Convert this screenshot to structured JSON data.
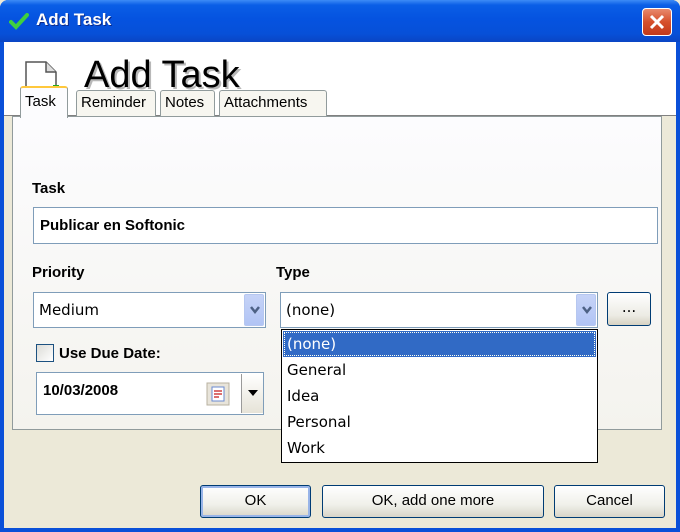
{
  "window": {
    "title": "Add Task"
  },
  "header": {
    "title": "Add Task"
  },
  "tabs": [
    {
      "label": "Task",
      "active": true
    },
    {
      "label": "Reminder",
      "active": false
    },
    {
      "label": "Notes",
      "active": false
    },
    {
      "label": "Attachments",
      "active": false
    }
  ],
  "task": {
    "label": "Task",
    "value": "Publicar en Softonic"
  },
  "priority": {
    "label": "Priority",
    "value": "Medium"
  },
  "type": {
    "label": "Type",
    "value": "(none)",
    "browse_label": "...",
    "options": [
      "(none)",
      "General",
      "Idea",
      "Personal",
      "Work"
    ]
  },
  "due_date": {
    "checkbox_label": "Use Due Date:",
    "checked": false,
    "value": "10/03/2008"
  },
  "buttons": {
    "ok": "OK",
    "ok_add_more": "OK, add one more",
    "cancel": "Cancel"
  },
  "colors": {
    "titlebar": "#0553e0",
    "selection": "#316ac5",
    "close": "#d6502c"
  }
}
